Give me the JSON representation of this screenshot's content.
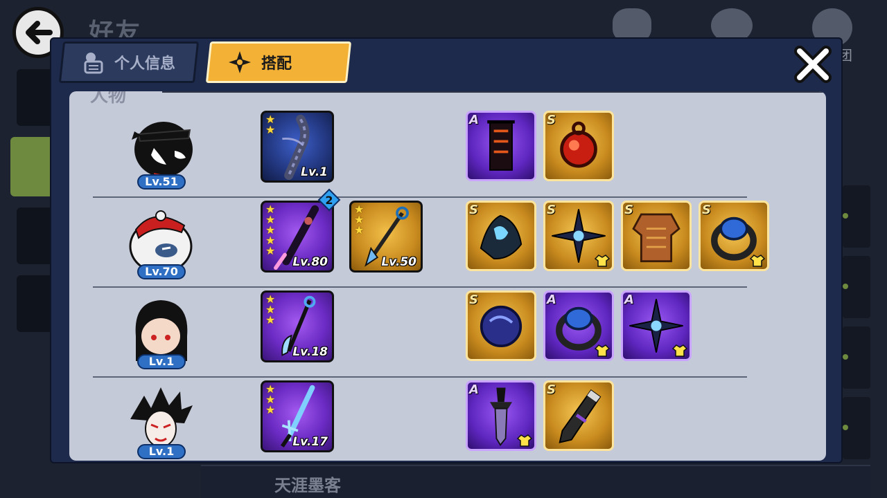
{
  "background": {
    "page_title": "好友",
    "right_label": "团",
    "friend_name": "天涯墨客"
  },
  "tabs": [
    {
      "label": "个人信息",
      "active": false
    },
    {
      "label": "搭配",
      "active": true
    }
  ],
  "panel": {
    "heading": "人物"
  },
  "rows": [
    {
      "level": "Lv.51",
      "weapons": [
        {
          "level": "Lv.1",
          "stars": 2,
          "color": "blue"
        }
      ],
      "gear": [
        {
          "grade": "A",
          "color": "purple",
          "icon": "banner-icon",
          "shirt": false
        },
        {
          "grade": "S",
          "color": "gold",
          "icon": "red-orb-icon",
          "shirt": false
        }
      ]
    },
    {
      "level": "Lv.70",
      "weapons": [
        {
          "level": "Lv.80",
          "stars": 5,
          "color": "purple",
          "badge": "2"
        },
        {
          "level": "Lv.50",
          "stars": 3,
          "color": "gold"
        }
      ],
      "gear": [
        {
          "grade": "S",
          "color": "gold",
          "icon": "blue-flame-icon",
          "shirt": false
        },
        {
          "grade": "S",
          "color": "gold",
          "icon": "shuriken-icon",
          "shirt": true
        },
        {
          "grade": "S",
          "color": "gold",
          "icon": "armor-icon",
          "shirt": false
        },
        {
          "grade": "S",
          "color": "gold",
          "icon": "ring-icon",
          "shirt": true
        }
      ]
    },
    {
      "level": "Lv.1",
      "weapons": [
        {
          "level": "Lv.18",
          "stars": 3,
          "color": "purple"
        }
      ],
      "gear": [
        {
          "grade": "S",
          "color": "gold",
          "icon": "dark-orb-icon",
          "shirt": false
        },
        {
          "grade": "A",
          "color": "purple",
          "icon": "ring-icon",
          "shirt": true
        },
        {
          "grade": "A",
          "color": "purple",
          "icon": "shuriken-icon",
          "shirt": true
        }
      ]
    },
    {
      "level": "Lv.1",
      "weapons": [
        {
          "level": "Lv.17",
          "stars": 3,
          "color": "purple"
        }
      ],
      "gear": [
        {
          "grade": "A",
          "color": "purple",
          "icon": "dagger-icon",
          "shirt": true
        },
        {
          "grade": "S",
          "color": "gold",
          "icon": "horn-icon",
          "shirt": false
        }
      ]
    }
  ],
  "colors": {
    "accent_tab": "#f3b236",
    "panel_bg": "#c5cad9",
    "modal_bg": "#1e2a4c",
    "level_badge": "#2f70c4"
  }
}
